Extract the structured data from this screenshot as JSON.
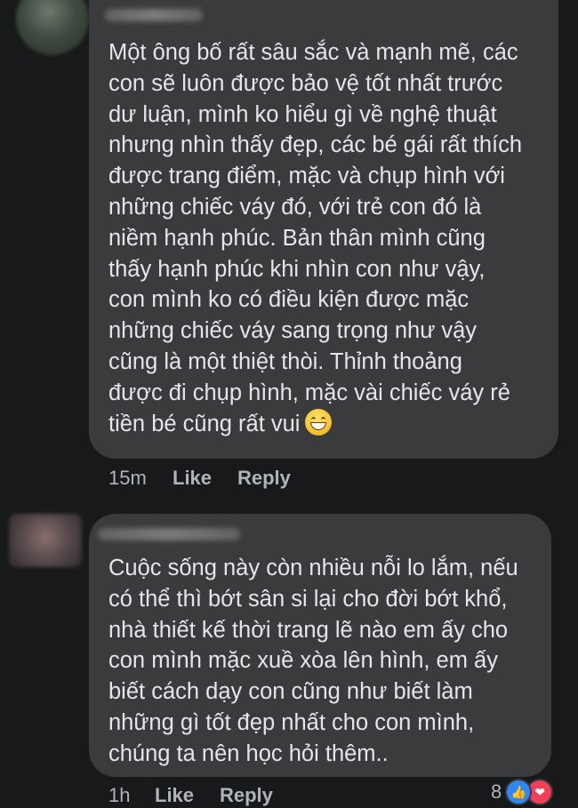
{
  "comments": [
    {
      "text": "Một ông bố rất sâu sắc và mạnh mẽ, các\ncon sẽ luôn được bảo vệ tốt nhất trước\ndư luận, mình ko hiểu gì về nghệ thuật\nnhưng nhìn thấy đẹp, các bé gái rất thích\nđược trang điểm, mặc và chụp hình với\nnhững chiếc váy đó, với trẻ con đó là\nniềm hạnh phúc. Bản thân mình cũng\nthấy hạnh phúc khi nhìn con như vậy,\ncon mình ko có điều kiện được mặc\nnhững chiếc váy sang trọng như vậy\ncũng là một thiệt thòi. Thỉnh thoảng\nđược đi chụp hình, mặc vài chiếc váy rẻ\ntiền bé cũng rất vui",
      "emoji": "grinning-face",
      "time": "15m",
      "like_label": "Like",
      "reply_label": "Reply"
    },
    {
      "text": "Cuộc sống này còn nhiều nỗi lo lắm, nếu\ncó thể thì bớt sân si lại cho đời bớt khổ,\nnhà thiết kế thời trang lẽ nào em ấy cho\ncon mình mặc xuề xòa lên hình, em ấy\nbiết cách dạy con cũng như biết làm\nnhững gì tốt đẹp nhất cho con mình,\nchúng ta nên học hỏi thêm..",
      "time": "1h",
      "like_label": "Like",
      "reply_label": "Reply",
      "reaction_count": "8",
      "reactions": [
        "like-icon",
        "love-icon"
      ]
    }
  ],
  "colors": {
    "background": "#18191a",
    "bubble": "#3a3b3c",
    "text": "#e4e6eb",
    "meta": "#b0b3b8",
    "like_reaction": "#2d88ff",
    "love_reaction": "#f33e58"
  }
}
